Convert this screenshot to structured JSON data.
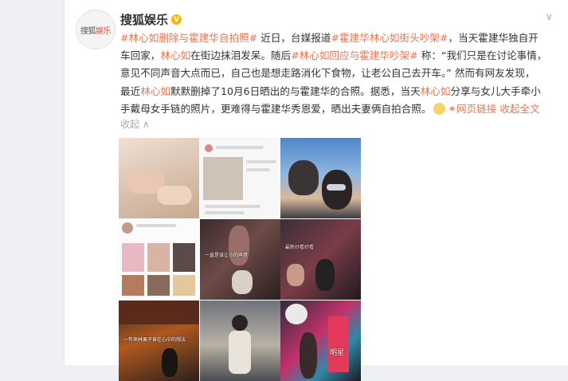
{
  "account": {
    "name": "搜狐娱乐",
    "avatar_text_a": "搜狐",
    "avatar_text_b": "娱乐",
    "verified_badge": "V"
  },
  "post": {
    "lines": [
      [
        {
          "t": "#林心如删除与霍建华自拍照#",
          "hl": true
        },
        {
          "t": " 近日，台媒报道",
          "hl": false
        },
        {
          "t": "#霍建华林心如街头吵架#",
          "hl": true
        },
        {
          "t": "，当天霍建华独自开",
          "hl": false
        }
      ],
      [
        {
          "t": "车回家，",
          "hl": false
        },
        {
          "t": "林心如",
          "hl": true
        },
        {
          "t": "在街边抹泪发呆。随后",
          "hl": false
        },
        {
          "t": "#林心如回应与霍建华吵架#",
          "hl": true
        },
        {
          "t": " 称：“我们只是在讨论事情，",
          "hl": false
        }
      ],
      [
        {
          "t": "意见不同声音大点而已，自己也是想走路消化下食物，让老公自己去开车。” 然而有网友发现，",
          "hl": false
        }
      ],
      [
        {
          "t": "最近",
          "hl": false
        },
        {
          "t": "林心如",
          "hl": true
        },
        {
          "t": "默默删掉了10月6日晒出的与霍建华的合照。据悉，当天",
          "hl": false
        },
        {
          "t": "林心如",
          "hl": true
        },
        {
          "t": "分享与女儿大手牵小",
          "hl": false
        }
      ],
      [
        {
          "t": "手戴母女手链的照片，更难得与霍建华秀恩爱，晒出夫妻俩自拍合照。",
          "hl": false
        }
      ]
    ],
    "web_link_label": "网页链接",
    "expand_label": "收起全文",
    "collapse_icon": "收起 ∧"
  },
  "photos": {
    "p7_caption": "一年来林果子曾在心中的想法",
    "p5_caption": "一直是该让小的声音",
    "p6_caption": "最新好看好看",
    "p9_sign": "明星"
  },
  "colors": {
    "accent": "#eb7350",
    "verified": "#ffb400"
  }
}
